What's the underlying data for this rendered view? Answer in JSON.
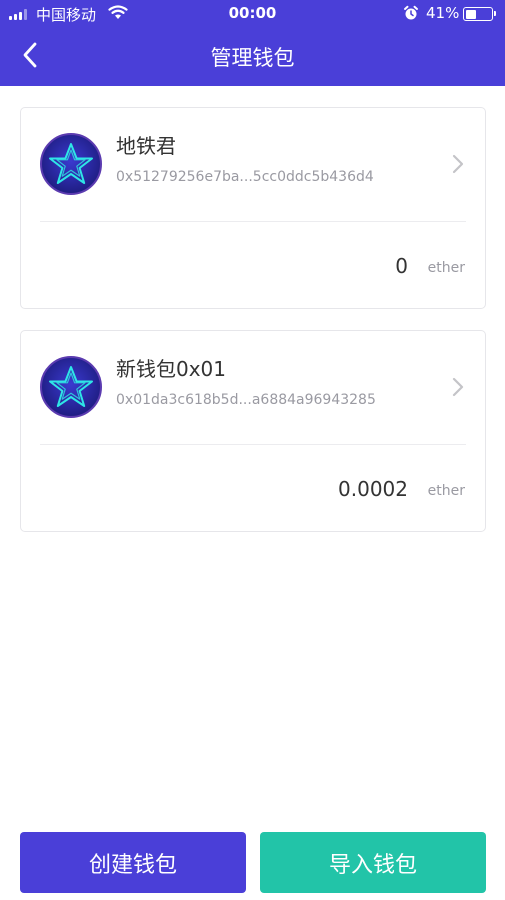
{
  "status_bar": {
    "carrier": "中国移动",
    "time": "00:00",
    "battery": "41%",
    "battery_level": 0.41,
    "icons": [
      "signal-icon",
      "wifi-icon",
      "alarm-icon",
      "battery-icon"
    ]
  },
  "header": {
    "title": "管理钱包",
    "back_icon": "chevron-left-icon"
  },
  "wallets": [
    {
      "name": "地铁君",
      "address": "0x51279256e7ba...5cc0ddc5b436d4",
      "balance": "0",
      "unit": "ether"
    },
    {
      "name": "新钱包0x01",
      "address": "0x01da3c618b5d...a6884a96943285",
      "balance": "0.0002",
      "unit": "ether"
    }
  ],
  "actions": {
    "create": "创建钱包",
    "import": "导入钱包"
  },
  "colors": {
    "primary": "#4a3fd8",
    "accent": "#22c4a8",
    "avatar_bg": "#2a2aa8",
    "star": "#2ee6e6"
  }
}
